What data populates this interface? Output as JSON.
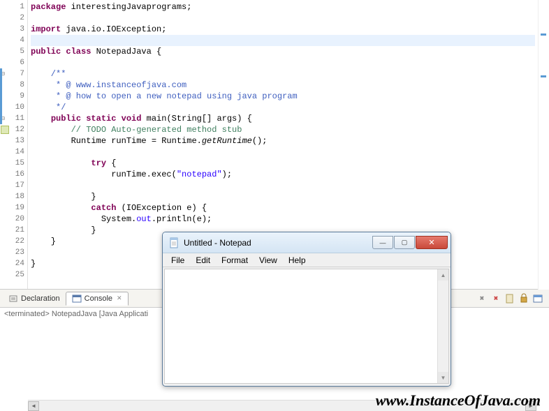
{
  "code": {
    "lines": [
      {
        "n": 1,
        "parts": [
          {
            "t": "package ",
            "c": "kw"
          },
          {
            "t": "interestingJavaprograms;"
          }
        ]
      },
      {
        "n": 2,
        "parts": []
      },
      {
        "n": 3,
        "parts": [
          {
            "t": "import ",
            "c": "kw"
          },
          {
            "t": "java.io.IOException;"
          }
        ]
      },
      {
        "n": 4,
        "parts": [],
        "highlight": true
      },
      {
        "n": 5,
        "parts": [
          {
            "t": "public class ",
            "c": "kw"
          },
          {
            "t": "NotepadJava {"
          }
        ]
      },
      {
        "n": 6,
        "parts": []
      },
      {
        "n": 7,
        "fold": true,
        "bluebar": true,
        "parts": [
          {
            "t": "    /**",
            "c": "com"
          }
        ]
      },
      {
        "n": 8,
        "bluebar": true,
        "parts": [
          {
            "t": "     * @ www.instanceofjava.com",
            "c": "com"
          }
        ]
      },
      {
        "n": 9,
        "bluebar": true,
        "parts": [
          {
            "t": "     * @ how to open a new notepad using java program",
            "c": "com"
          }
        ]
      },
      {
        "n": 10,
        "bluebar": true,
        "parts": [
          {
            "t": "     */",
            "c": "com"
          }
        ]
      },
      {
        "n": 11,
        "fold": true,
        "bluebar": true,
        "parts": [
          {
            "t": "    ",
            "c": ""
          },
          {
            "t": "public static void ",
            "c": "kw"
          },
          {
            "t": "main(String[] args) {"
          }
        ]
      },
      {
        "n": 12,
        "marker": true,
        "parts": [
          {
            "t": "        ",
            "c": ""
          },
          {
            "t": "// TODO Auto-generated method stub",
            "c": "linecom"
          }
        ]
      },
      {
        "n": 13,
        "parts": [
          {
            "t": "        Runtime runTime = Runtime."
          },
          {
            "t": "getRuntime",
            "c": "method"
          },
          {
            "t": "();"
          }
        ]
      },
      {
        "n": 14,
        "parts": []
      },
      {
        "n": 15,
        "parts": [
          {
            "t": "            ",
            "c": ""
          },
          {
            "t": "try ",
            "c": "kw"
          },
          {
            "t": "{"
          }
        ]
      },
      {
        "n": 16,
        "parts": [
          {
            "t": "                runTime.exec("
          },
          {
            "t": "\"notepad\"",
            "c": "str"
          },
          {
            "t": ");"
          }
        ]
      },
      {
        "n": 17,
        "parts": []
      },
      {
        "n": 18,
        "parts": [
          {
            "t": "            }"
          }
        ]
      },
      {
        "n": 19,
        "parts": [
          {
            "t": "            ",
            "c": ""
          },
          {
            "t": "catch ",
            "c": "kw"
          },
          {
            "t": "(IOException e) {"
          }
        ]
      },
      {
        "n": 20,
        "parts": [
          {
            "t": "              System."
          },
          {
            "t": "out",
            "c": "str"
          },
          {
            "t": ".println(e);"
          }
        ]
      },
      {
        "n": 21,
        "parts": [
          {
            "t": "            }"
          }
        ]
      },
      {
        "n": 22,
        "parts": [
          {
            "t": "    }"
          }
        ]
      },
      {
        "n": 23,
        "parts": []
      },
      {
        "n": 24,
        "parts": [
          {
            "t": "}"
          }
        ]
      },
      {
        "n": 25,
        "parts": []
      }
    ]
  },
  "tabs": {
    "declaration": "Declaration",
    "console": "Console",
    "close_icon": "✕"
  },
  "console_status": "<terminated> NotepadJava [Java Applicati",
  "notepad": {
    "title": "Untitled - Notepad",
    "menu": [
      "File",
      "Edit",
      "Format",
      "View",
      "Help"
    ]
  },
  "watermark": "www.InstanceOfJava.com"
}
